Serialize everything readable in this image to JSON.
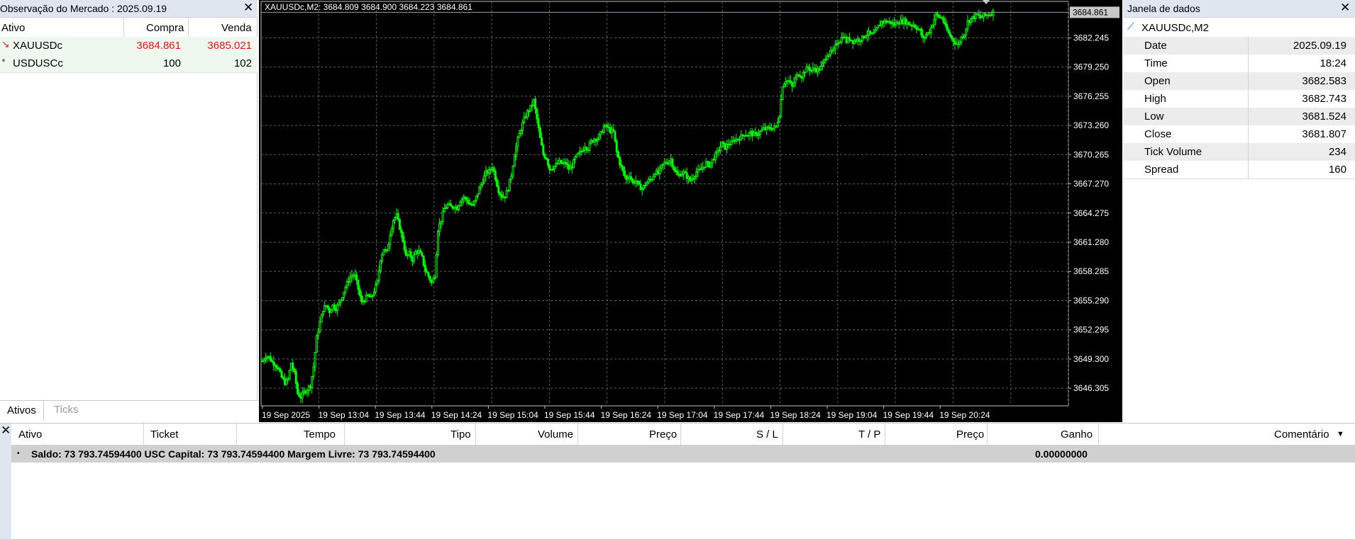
{
  "market_watch": {
    "title": "Observação do Mercado : 2025.09.19",
    "columns": {
      "symbol": "Ativo",
      "bid": "Compra",
      "ask": "Venda"
    },
    "rows": [
      {
        "symbol": "XAUUSDc",
        "bid": "3684.861",
        "ask": "3685.021",
        "icon": "arrow-down-red-icon"
      },
      {
        "symbol": "USDUSCc",
        "bid": "100",
        "ask": "102",
        "icon": "dot-icon"
      }
    ],
    "tabs": [
      "Ativos",
      "Ticks"
    ],
    "active_tab": "Ativos"
  },
  "chart_info": "XAUUSDc,M2: 3684.809 3684.900 3684.223 3684.861",
  "chart_data": {
    "type": "candlestick",
    "symbol": "XAUUSDc",
    "timeframe": "M2",
    "price_labels": [
      "3682.245",
      "3679.250",
      "3676.255",
      "3673.260",
      "3670.265",
      "3667.270",
      "3664.275",
      "3661.280",
      "3658.285",
      "3655.290",
      "3652.295",
      "3649.300",
      "3646.305"
    ],
    "current_price_label": "3684.861",
    "time_labels": [
      "19 Sep 2025",
      "19 Sep 13:04",
      "19 Sep 13:44",
      "19 Sep 14:24",
      "19 Sep 15:04",
      "19 Sep 15:44",
      "19 Sep 16:24",
      "19 Sep 17:04",
      "19 Sep 17:44",
      "19 Sep 18:24",
      "19 Sep 19:04",
      "19 Sep 19:44",
      "19 Sep 20:24"
    ],
    "ylim": [
      3644.5,
      3685.4
    ],
    "grid": true,
    "close_path": [
      [
        0,
        3649.1
      ],
      [
        2,
        3649.6
      ],
      [
        4,
        3649.5
      ],
      [
        6,
        3649.0
      ],
      [
        8,
        3648.8
      ],
      [
        10,
        3648.2
      ],
      [
        12,
        3647.4
      ],
      [
        14,
        3646.9
      ],
      [
        16,
        3647.2
      ],
      [
        18,
        3648.9
      ],
      [
        20,
        3647.8
      ],
      [
        22,
        3645.8
      ],
      [
        24,
        3645.4
      ],
      [
        26,
        3645.9
      ],
      [
        28,
        3646.2
      ],
      [
        30,
        3646.6
      ],
      [
        32,
        3648.5
      ],
      [
        34,
        3651.5
      ],
      [
        36,
        3653.0
      ],
      [
        38,
        3654.4
      ],
      [
        40,
        3654.8
      ],
      [
        42,
        3654.2
      ],
      [
        44,
        3654.8
      ],
      [
        46,
        3654.5
      ],
      [
        48,
        3655.0
      ],
      [
        50,
        3655.8
      ],
      [
        52,
        3656.7
      ],
      [
        54,
        3657.4
      ],
      [
        56,
        3657.9
      ],
      [
        58,
        3657.8
      ],
      [
        60,
        3656.5
      ],
      [
        62,
        3655.1
      ],
      [
        64,
        3655.4
      ],
      [
        66,
        3655.8
      ],
      [
        68,
        3655.5
      ],
      [
        70,
        3656.3
      ],
      [
        72,
        3657.2
      ],
      [
        74,
        3659.6
      ],
      [
        76,
        3660.6
      ],
      [
        78,
        3660.2
      ],
      [
        80,
        3662.2
      ],
      [
        82,
        3663.6
      ],
      [
        84,
        3664.0
      ],
      [
        86,
        3662.8
      ],
      [
        88,
        3661.5
      ],
      [
        90,
        3659.8
      ],
      [
        92,
        3660.1
      ],
      [
        94,
        3659.5
      ],
      [
        96,
        3660.3
      ],
      [
        98,
        3660.3
      ],
      [
        100,
        3659.7
      ],
      [
        102,
        3658.4
      ],
      [
        104,
        3657.8
      ],
      [
        106,
        3657.1
      ],
      [
        108,
        3657.9
      ],
      [
        110,
        3662.6
      ],
      [
        112,
        3663.6
      ],
      [
        114,
        3664.7
      ],
      [
        116,
        3665.1
      ],
      [
        118,
        3664.9
      ],
      [
        120,
        3665.0
      ],
      [
        122,
        3664.8
      ],
      [
        124,
        3665.6
      ],
      [
        126,
        3665.9
      ],
      [
        128,
        3665.6
      ],
      [
        130,
        3665.2
      ],
      [
        132,
        3665.0
      ],
      [
        134,
        3665.9
      ],
      [
        136,
        3666.8
      ],
      [
        138,
        3667.6
      ],
      [
        140,
        3668.4
      ],
      [
        142,
        3668.5
      ],
      [
        144,
        3669.1
      ],
      [
        146,
        3667.9
      ],
      [
        148,
        3666.6
      ],
      [
        150,
        3666.0
      ],
      [
        152,
        3666.0
      ],
      [
        154,
        3666.8
      ],
      [
        156,
        3668.2
      ],
      [
        158,
        3670.3
      ],
      [
        160,
        3671.8
      ],
      [
        162,
        3672.9
      ],
      [
        164,
        3673.9
      ],
      [
        166,
        3674.6
      ],
      [
        168,
        3675.1
      ],
      [
        170,
        3675.8
      ],
      [
        172,
        3673.9
      ],
      [
        174,
        3671.9
      ],
      [
        176,
        3670.3
      ],
      [
        178,
        3669.9
      ],
      [
        180,
        3668.8
      ],
      [
        182,
        3669.0
      ],
      [
        184,
        3669.2
      ],
      [
        186,
        3669.5
      ],
      [
        188,
        3669.3
      ],
      [
        190,
        3669.4
      ],
      [
        192,
        3668.8
      ],
      [
        194,
        3669.1
      ],
      [
        196,
        3669.9
      ],
      [
        198,
        3670.3
      ],
      [
        200,
        3670.6
      ],
      [
        202,
        3671.2
      ],
      [
        204,
        3670.9
      ],
      [
        206,
        3671.6
      ],
      [
        208,
        3671.9
      ],
      [
        210,
        3671.9
      ],
      [
        212,
        3672.4
      ],
      [
        214,
        3673.1
      ],
      [
        216,
        3673.1
      ],
      [
        218,
        3672.7
      ],
      [
        220,
        3672.6
      ],
      [
        222,
        3670.5
      ],
      [
        224,
        3669.4
      ],
      [
        226,
        3668.5
      ],
      [
        228,
        3667.7
      ],
      [
        230,
        3668.2
      ],
      [
        232,
        3667.4
      ],
      [
        234,
        3667.6
      ],
      [
        236,
        3667.0
      ],
      [
        238,
        3666.8
      ],
      [
        240,
        3667.2
      ],
      [
        242,
        3667.6
      ],
      [
        244,
        3667.8
      ],
      [
        246,
        3668.5
      ],
      [
        248,
        3668.3
      ],
      [
        250,
        3669.0
      ],
      [
        252,
        3669.4
      ],
      [
        254,
        3669.5
      ],
      [
        256,
        3669.8
      ],
      [
        258,
        3668.8
      ],
      [
        260,
        3668.1
      ],
      [
        262,
        3668.3
      ],
      [
        264,
        3668.4
      ],
      [
        266,
        3668.0
      ],
      [
        268,
        3667.6
      ],
      [
        270,
        3668.0
      ],
      [
        272,
        3668.5
      ],
      [
        274,
        3668.6
      ],
      [
        276,
        3669.0
      ],
      [
        278,
        3669.4
      ],
      [
        280,
        3669.2
      ],
      [
        282,
        3669.7
      ],
      [
        284,
        3670.2
      ],
      [
        286,
        3670.8
      ],
      [
        288,
        3671.4
      ],
      [
        290,
        3671.0
      ],
      [
        292,
        3671.4
      ],
      [
        294,
        3671.4
      ],
      [
        296,
        3671.8
      ],
      [
        298,
        3671.9
      ],
      [
        300,
        3672.1
      ],
      [
        302,
        3672.4
      ],
      [
        304,
        3672.3
      ],
      [
        306,
        3672.5
      ],
      [
        308,
        3672.3
      ],
      [
        310,
        3672.4
      ],
      [
        312,
        3672.6
      ],
      [
        314,
        3672.9
      ],
      [
        316,
        3672.9
      ],
      [
        318,
        3673.0
      ],
      [
        320,
        3673.0
      ],
      [
        322,
        3673.1
      ],
      [
        324,
        3674.4
      ],
      [
        326,
        3677.4
      ],
      [
        328,
        3677.9
      ],
      [
        330,
        3677.8
      ],
      [
        332,
        3677.2
      ],
      [
        334,
        3678.1
      ],
      [
        336,
        3678.6
      ],
      [
        338,
        3678.3
      ],
      [
        340,
        3678.9
      ],
      [
        342,
        3679.2
      ],
      [
        344,
        3678.9
      ],
      [
        346,
        3679.1
      ],
      [
        348,
        3678.9
      ],
      [
        350,
        3679.2
      ],
      [
        352,
        3679.9
      ],
      [
        354,
        3680.6
      ],
      [
        356,
        3680.7
      ],
      [
        358,
        3680.9
      ],
      [
        360,
        3681.8
      ],
      [
        362,
        3682.0
      ],
      [
        364,
        3682.5
      ],
      [
        366,
        3681.9
      ],
      [
        368,
        3682.2
      ],
      [
        370,
        3681.9
      ],
      [
        372,
        3682.0
      ],
      [
        374,
        3682.1
      ],
      [
        376,
        3682.2
      ],
      [
        378,
        3682.6
      ],
      [
        380,
        3682.7
      ],
      [
        382,
        3682.5
      ],
      [
        384,
        3682.8
      ],
      [
        386,
        3683.4
      ],
      [
        388,
        3683.9
      ],
      [
        390,
        3683.9
      ],
      [
        392,
        3683.9
      ],
      [
        394,
        3683.8
      ],
      [
        396,
        3683.6
      ],
      [
        398,
        3683.9
      ],
      [
        400,
        3683.9
      ],
      [
        402,
        3684.0
      ],
      [
        404,
        3683.8
      ],
      [
        406,
        3683.6
      ],
      [
        408,
        3683.6
      ],
      [
        410,
        3683.3
      ],
      [
        412,
        3683.0
      ],
      [
        414,
        3682.1
      ],
      [
        416,
        3682.6
      ],
      [
        418,
        3682.9
      ],
      [
        420,
        3683.7
      ],
      [
        422,
        3684.6
      ],
      [
        424,
        3684.4
      ],
      [
        426,
        3684.3
      ],
      [
        428,
        3683.4
      ],
      [
        430,
        3682.7
      ],
      [
        432,
        3682.2
      ],
      [
        434,
        3681.8
      ],
      [
        436,
        3681.5
      ],
      [
        438,
        3682.3
      ],
      [
        440,
        3682.7
      ],
      [
        442,
        3683.9
      ],
      [
        444,
        3684.2
      ],
      [
        446,
        3684.4
      ],
      [
        448,
        3684.6
      ],
      [
        450,
        3684.3
      ],
      [
        452,
        3684.5
      ],
      [
        454,
        3684.6
      ],
      [
        456,
        3684.7
      ],
      [
        458,
        3684.9
      ]
    ]
  },
  "data_window": {
    "title": "Janela de dados",
    "series_label": "XAUUSDc,M2",
    "rows": [
      {
        "key": "Date",
        "value": "2025.09.19"
      },
      {
        "key": "Time",
        "value": "18:24"
      },
      {
        "key": "Open",
        "value": "3682.583"
      },
      {
        "key": "High",
        "value": "3682.743"
      },
      {
        "key": "Low",
        "value": "3681.524"
      },
      {
        "key": "Close",
        "value": "3681.807"
      },
      {
        "key": "Tick Volume",
        "value": "234"
      },
      {
        "key": "Spread",
        "value": "160"
      }
    ]
  },
  "toolbox": {
    "columns": [
      "Ativo",
      "Ticket",
      "Tempo",
      "Tipo",
      "Volume",
      "Preço",
      "S / L",
      "T / P",
      "Preço",
      "Ganho",
      "Comentário"
    ],
    "balance_text": "Saldo: 73 793.74594400 USC  Capital: 73 793.74594400  Margem Livre: 73 793.74594400",
    "profit": "0.00000000"
  },
  "colors": {
    "candle_green": "#00ff00",
    "chart_bg": "#000000",
    "grid": "#5a5f6a",
    "bid_ask_red": "#ee1111",
    "row_bg": "#eef8ee",
    "panel_header_bg": "#dfe6ef"
  }
}
